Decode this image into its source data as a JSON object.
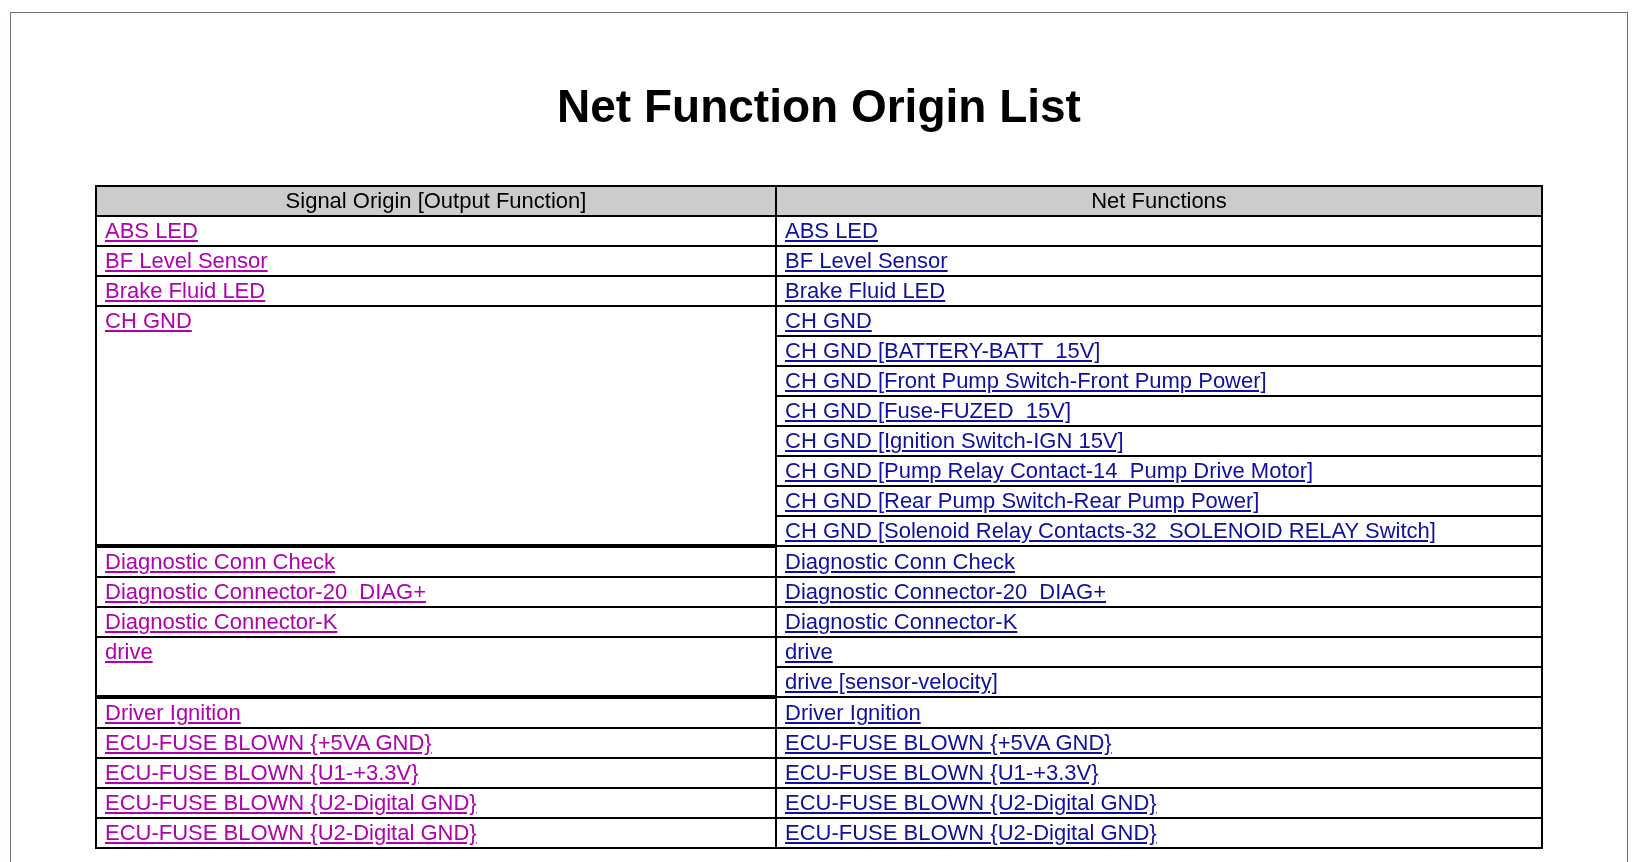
{
  "title": "Net Function Origin List",
  "table": {
    "columns": [
      "Signal Origin [Output Function]",
      "Net Functions"
    ],
    "groups": [
      {
        "origin": "ABS LED",
        "nets": [
          "ABS LED"
        ]
      },
      {
        "origin": "BF Level Sensor",
        "nets": [
          "BF Level Sensor"
        ]
      },
      {
        "origin": "Brake Fluid LED",
        "nets": [
          "Brake Fluid LED"
        ]
      },
      {
        "origin": "CH GND",
        "nets": [
          "CH GND",
          "CH GND [BATTERY-BATT  15V]",
          "CH GND [Front Pump Switch-Front Pump Power]",
          "CH GND [Fuse-FUZED  15V]",
          "CH GND [Ignition Switch-IGN 15V]",
          "CH GND [Pump Relay Contact-14  Pump Drive Motor]",
          "CH GND [Rear Pump Switch-Rear Pump Power]",
          "CH GND [Solenoid Relay Contacts-32  SOLENOID RELAY Switch]"
        ]
      },
      {
        "origin": "Diagnostic Conn Check",
        "nets": [
          "Diagnostic Conn Check"
        ]
      },
      {
        "origin": "Diagnostic Connector-20  DIAG+",
        "nets": [
          "Diagnostic Connector-20  DIAG+"
        ]
      },
      {
        "origin": "Diagnostic Connector-K",
        "nets": [
          "Diagnostic Connector-K"
        ]
      },
      {
        "origin": "drive",
        "nets": [
          "drive",
          "drive [sensor-velocity]"
        ]
      },
      {
        "origin": "Driver Ignition",
        "nets": [
          "Driver Ignition"
        ]
      },
      {
        "origin": "ECU-FUSE BLOWN {+5VA GND}",
        "nets": [
          "ECU-FUSE BLOWN {+5VA GND}"
        ]
      },
      {
        "origin": "ECU-FUSE BLOWN {U1-+3.3V}",
        "nets": [
          "ECU-FUSE BLOWN {U1-+3.3V}"
        ]
      },
      {
        "origin": "ECU-FUSE BLOWN {U2-Digital GND}",
        "nets": [
          "ECU-FUSE BLOWN {U2-Digital GND}"
        ]
      },
      {
        "origin": "ECU-FUSE BLOWN {U2-Digital GND}",
        "nets": [
          "ECU-FUSE BLOWN {U2-Digital GND}"
        ]
      }
    ]
  }
}
